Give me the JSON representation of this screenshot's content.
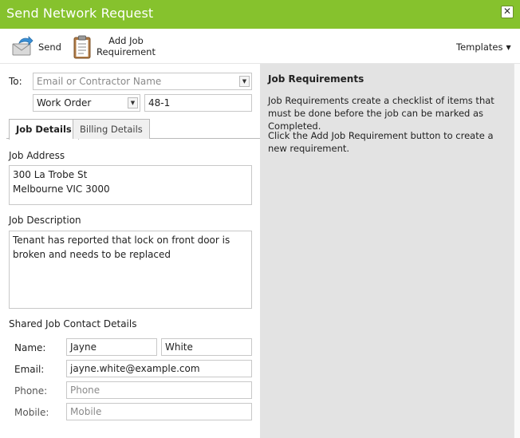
{
  "window": {
    "title": "Send Network Request",
    "close_glyph": "✕",
    "title_bar_color": "#86c22d"
  },
  "toolbar": {
    "send_label": "Send",
    "add_job_requirement_line1": "Add Job",
    "add_job_requirement_line2": "Requirement",
    "templates_label": "Templates",
    "templates_caret": "▼"
  },
  "form": {
    "to_label": "To:",
    "to_placeholder": "Email or Contractor Name",
    "type_value": "Work Order",
    "number_value": "48-1",
    "select_arrow_glyph": "▼"
  },
  "tabs": [
    {
      "label": "Job Details",
      "active": true
    },
    {
      "label": "Billing Details",
      "active": false
    }
  ],
  "job_details": {
    "address_label": "Job Address",
    "address_value": "300 La Trobe St\nMelbourne VIC 3000",
    "description_label": "Job Description",
    "description_value": "Tenant has reported that lock on front door is\nbroken and needs to be replaced",
    "shared_contact_heading": "Shared Job Contact Details",
    "name_label": "Name:",
    "first_name": "Jayne",
    "last_name": "White",
    "email_label": "Email:",
    "email_value": "jayne.white@example.com",
    "phone_label": "Phone:",
    "phone_placeholder": "Phone",
    "mobile_label": "Mobile:",
    "mobile_placeholder": "Mobile"
  },
  "job_requirements_panel": {
    "title": "Job Requirements",
    "paragraph1": "Job Requirements create a checklist of items that must be done before the job can be marked as Completed.",
    "paragraph2": "Click the Add Job Requirement button to create a new requirement."
  },
  "icons": {
    "send": "send-envelope-icon",
    "add_job_requirement": "clipboard-icon",
    "close": "close-icon",
    "dropdown": "chevron-down-icon"
  }
}
